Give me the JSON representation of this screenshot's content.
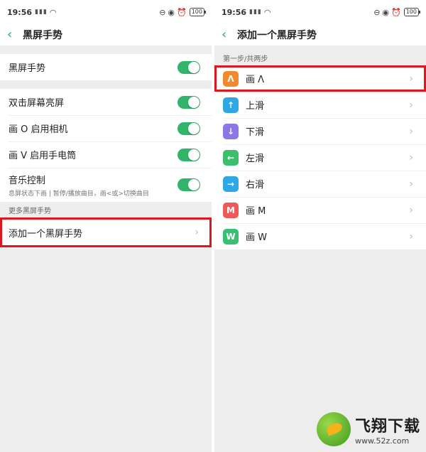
{
  "status_bar": {
    "time": "19:56",
    "signal_text": "5G",
    "battery": "100",
    "icons": [
      "signal-icon",
      "wifi-icon",
      "do-not-disturb-icon",
      "eye-icon",
      "alarm-icon",
      "battery-icon"
    ]
  },
  "left": {
    "title": "黑屏手势",
    "rows_group1": [
      {
        "label": "黑屏手势",
        "toggle": true
      }
    ],
    "rows_group2": [
      {
        "label": "双击屏幕亮屏",
        "toggle": true
      },
      {
        "label": "画 O 启用相机",
        "toggle": true
      },
      {
        "label": "画 V 启用手电筒",
        "toggle": true
      },
      {
        "label": "音乐控制",
        "sub": "息屏状态下画 | 暂停/播放曲目，画<或>切换曲目",
        "toggle": true
      }
    ],
    "section_label": "更多黑屏手势",
    "add_row_label": "添加一个黑屏手势"
  },
  "right": {
    "title": "添加一个黑屏手势",
    "step_label": "第一步/共两步",
    "gestures": [
      {
        "glyph": "Λ",
        "label": "画 Λ",
        "color": "#f28a2c"
      },
      {
        "glyph": "↑",
        "label": "上滑",
        "color": "#2ea7e5"
      },
      {
        "glyph": "↓",
        "label": "下滑",
        "color": "#8b78e6"
      },
      {
        "glyph": "←",
        "label": "左滑",
        "color": "#3bbf6a"
      },
      {
        "glyph": "→",
        "label": "右滑",
        "color": "#2ea7e5"
      },
      {
        "glyph": "M",
        "label": "画 M",
        "color": "#ee5a5a"
      },
      {
        "glyph": "W",
        "label": "画 W",
        "color": "#36c172"
      }
    ]
  },
  "watermark": {
    "main": "飞翔下载",
    "sub": "www.52z.com"
  },
  "colors": {
    "accent_green": "#27b35c",
    "toggle_on": "#32b56a",
    "highlight_red": "#e0161e",
    "background": "#ededed"
  }
}
